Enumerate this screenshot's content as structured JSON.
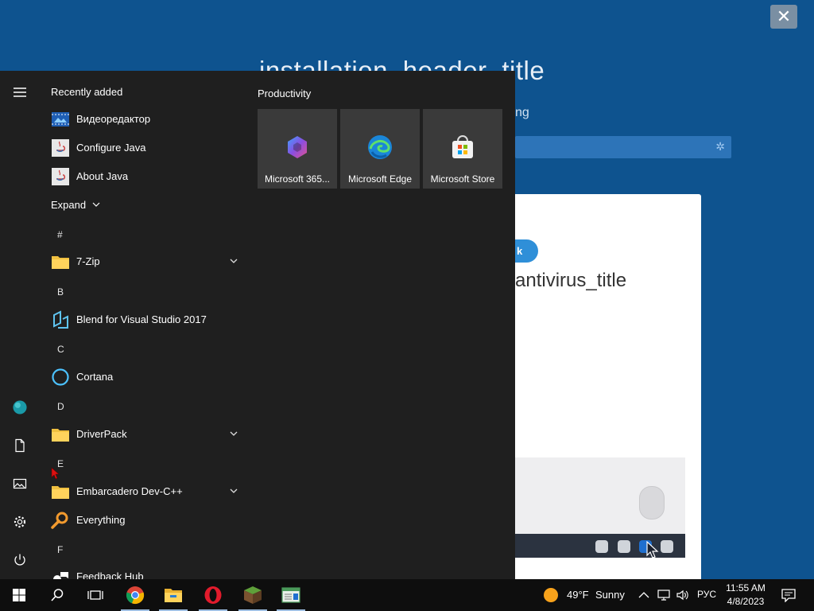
{
  "background_window": {
    "title": "installation_header_title",
    "subtitle_fragment": "ng",
    "pill_fragment": "k",
    "antivirus_title_fragment": "antivirus_title",
    "close_glyph": "✕"
  },
  "start_menu": {
    "recently_added_label": "Recently added",
    "expand_label": "Expand",
    "recent_items": [
      {
        "label": "Видеоредактор",
        "icon": "video-editor-icon"
      },
      {
        "label": "Configure Java",
        "icon": "java-icon"
      },
      {
        "label": "About Java",
        "icon": "java-icon"
      }
    ],
    "letters": [
      "#",
      "B",
      "C",
      "D",
      "E",
      "F"
    ],
    "apps": [
      {
        "label": "7-Zip",
        "icon": "folder-icon",
        "expandable": true
      },
      {
        "label": "Blend for Visual Studio 2017",
        "icon": "blend-icon",
        "expandable": false
      },
      {
        "label": "Cortana",
        "icon": "cortana-icon",
        "expandable": false
      },
      {
        "label": "DriverPack",
        "icon": "folder-icon",
        "expandable": true
      },
      {
        "label": "Embarcadero Dev-C++",
        "icon": "folder-icon",
        "expandable": true
      },
      {
        "label": "Everything",
        "icon": "search-magnifier-icon",
        "expandable": false
      },
      {
        "label": "Feedback Hub",
        "icon": "feedback-icon",
        "expandable": false
      }
    ],
    "pinned_group": "Productivity",
    "tiles": [
      {
        "label": "Microsoft 365...",
        "icon": "microsoft-365-icon"
      },
      {
        "label": "Microsoft Edge",
        "icon": "edge-icon"
      },
      {
        "label": "Microsoft Store",
        "icon": "store-icon"
      }
    ]
  },
  "taskbar": {
    "weather_temp": "49°F",
    "weather_text": "Sunny",
    "language": "РУС",
    "time": "11:55 AM",
    "date": "4/8/2023"
  },
  "colors": {
    "accent_blue": "#0e538f",
    "start_bg": "#1f1f1f",
    "tile_bg": "#3a3a3a",
    "taskbar_bg": "#0e0e0e"
  }
}
